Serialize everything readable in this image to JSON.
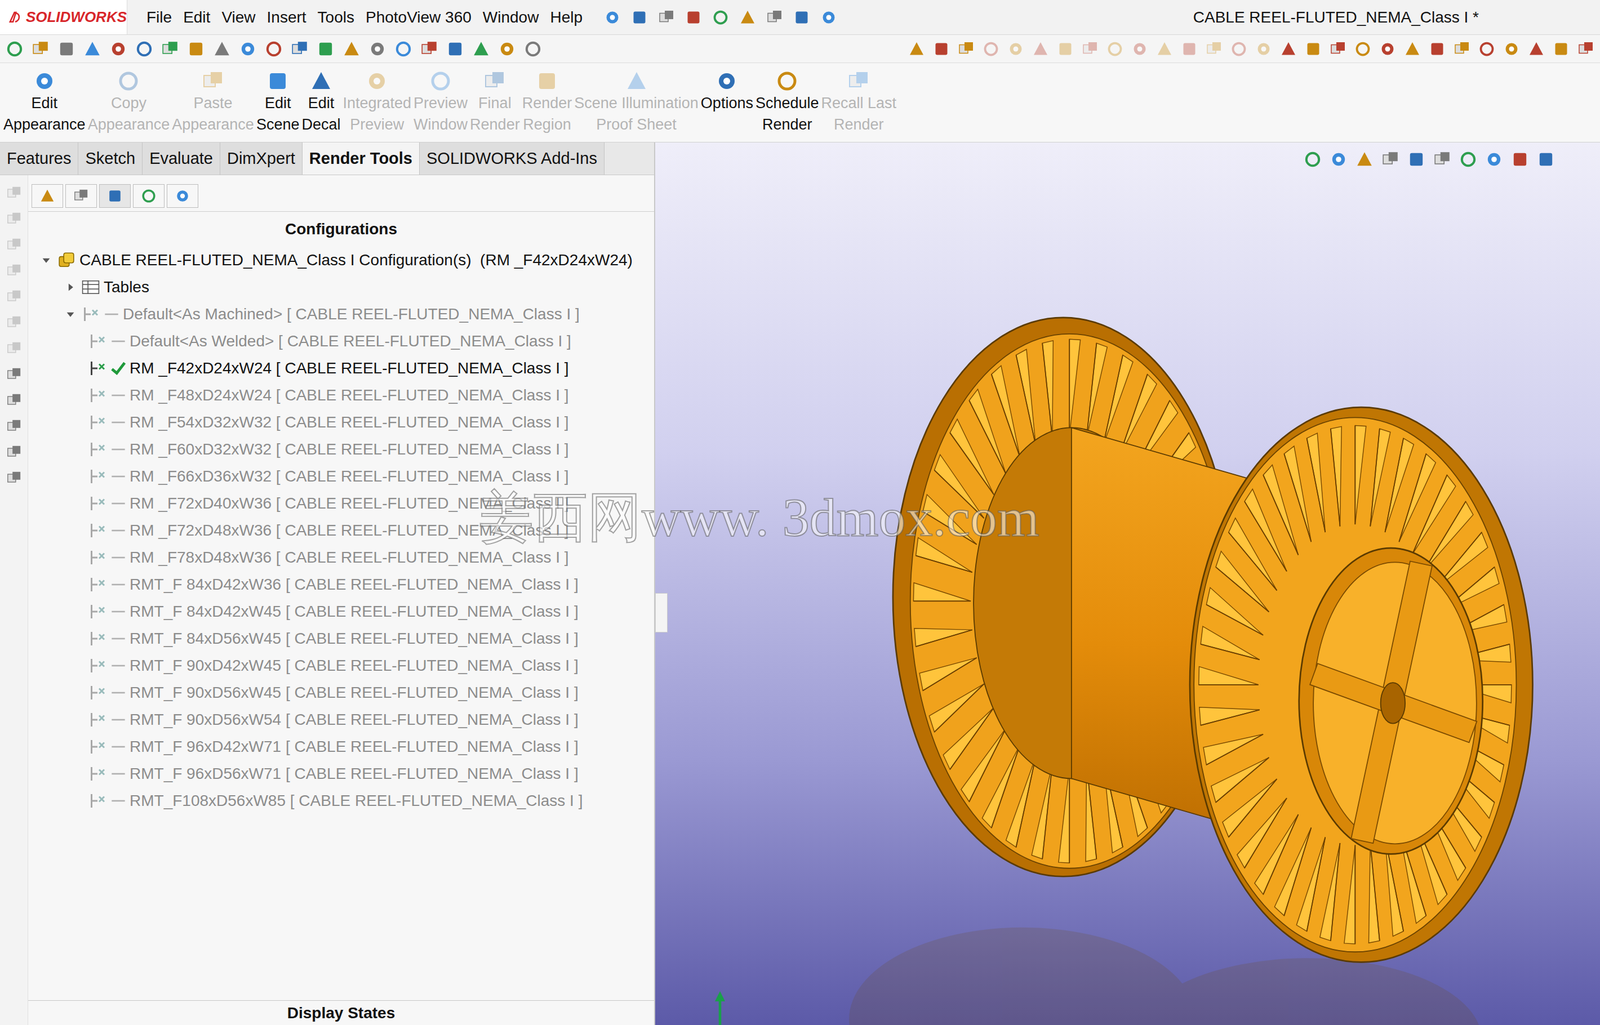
{
  "app": {
    "logo": "SOLIDWORKS",
    "title": "CABLE REEL-FLUTED_NEMA_Class I *"
  },
  "menu": [
    "File",
    "Edit",
    "View",
    "Insert",
    "Tools",
    "PhotoView 360",
    "Window",
    "Help"
  ],
  "commands": [
    {
      "lines": [
        "Edit",
        "Appearance"
      ],
      "disabled": false
    },
    {
      "lines": [
        "Copy",
        "Appearance"
      ],
      "disabled": true
    },
    {
      "lines": [
        "Paste",
        "Appearance"
      ],
      "disabled": true
    },
    {
      "lines": [
        "Edit",
        "Scene"
      ],
      "disabled": false
    },
    {
      "lines": [
        "Edit",
        "Decal"
      ],
      "disabled": false
    },
    {
      "lines": [
        "Integrated",
        "Preview"
      ],
      "disabled": true
    },
    {
      "lines": [
        "Preview",
        "Window"
      ],
      "disabled": true
    },
    {
      "lines": [
        "Final",
        "Render"
      ],
      "disabled": true
    },
    {
      "lines": [
        "Render",
        "Region"
      ],
      "disabled": true
    },
    {
      "lines": [
        "Scene Illumination",
        "Proof Sheet"
      ],
      "disabled": true
    },
    {
      "lines": [
        "Options",
        ""
      ],
      "disabled": false
    },
    {
      "lines": [
        "Schedule",
        "Render"
      ],
      "disabled": false
    },
    {
      "lines": [
        "Recall Last",
        "Render"
      ],
      "disabled": true
    }
  ],
  "tabs": [
    {
      "label": "Features",
      "selected": false
    },
    {
      "label": "Sketch",
      "selected": false
    },
    {
      "label": "Evaluate",
      "selected": false
    },
    {
      "label": "DimXpert",
      "selected": false
    },
    {
      "label": "Render Tools",
      "selected": true
    },
    {
      "label": "SOLIDWORKS Add-Ins",
      "selected": false
    }
  ],
  "panel": {
    "header": "Configurations",
    "footer": "Display States"
  },
  "tree": {
    "root": {
      "label": "CABLE REEL-FLUTED_NEMA_Class I Configuration(s)  (RM _F42xD24xW24)",
      "expanded": true
    },
    "items": [
      {
        "label": "Tables",
        "kind": "tables",
        "level": 1,
        "expanded": false,
        "active": false,
        "greyed": false
      },
      {
        "label": "Default<As Machined> [ CABLE REEL-FLUTED_NEMA_Class I ]",
        "kind": "parent",
        "level": 1,
        "expanded": true,
        "active": false,
        "greyed": true
      },
      {
        "label": "Default<As Welded> [ CABLE REEL-FLUTED_NEMA_Class I ]",
        "kind": "config",
        "level": 2,
        "expanded": false,
        "active": false,
        "greyed": true
      },
      {
        "label": "RM _F42xD24xW24 [ CABLE REEL-FLUTED_NEMA_Class I ]",
        "kind": "config",
        "level": 2,
        "expanded": false,
        "active": true,
        "greyed": false
      },
      {
        "label": "RM _F48xD24xW24 [ CABLE REEL-FLUTED_NEMA_Class I ]",
        "kind": "config",
        "level": 2,
        "expanded": false,
        "active": false,
        "greyed": true
      },
      {
        "label": "RM _F54xD32xW32 [ CABLE REEL-FLUTED_NEMA_Class I ]",
        "kind": "config",
        "level": 2,
        "expanded": false,
        "active": false,
        "greyed": true
      },
      {
        "label": "RM _F60xD32xW32 [ CABLE REEL-FLUTED_NEMA_Class I ]",
        "kind": "config",
        "level": 2,
        "expanded": false,
        "active": false,
        "greyed": true
      },
      {
        "label": "RM _F66xD36xW32 [ CABLE REEL-FLUTED_NEMA_Class I ]",
        "kind": "config",
        "level": 2,
        "expanded": false,
        "active": false,
        "greyed": true
      },
      {
        "label": "RM _F72xD40xW36 [ CABLE REEL-FLUTED_NEMA_Class I ]",
        "kind": "config",
        "level": 2,
        "expanded": false,
        "active": false,
        "greyed": true
      },
      {
        "label": "RM _F72xD48xW36 [ CABLE REEL-FLUTED_NEMA_Class I ]",
        "kind": "config",
        "level": 2,
        "expanded": false,
        "active": false,
        "greyed": true
      },
      {
        "label": "RM _F78xD48xW36 [ CABLE REEL-FLUTED_NEMA_Class I ]",
        "kind": "config",
        "level": 2,
        "expanded": false,
        "active": false,
        "greyed": true
      },
      {
        "label": "RMT_F 84xD42xW36 [ CABLE REEL-FLUTED_NEMA_Class I ]",
        "kind": "config",
        "level": 2,
        "expanded": false,
        "active": false,
        "greyed": true
      },
      {
        "label": "RMT_F 84xD42xW45 [ CABLE REEL-FLUTED_NEMA_Class I ]",
        "kind": "config",
        "level": 2,
        "expanded": false,
        "active": false,
        "greyed": true
      },
      {
        "label": "RMT_F 84xD56xW45 [ CABLE REEL-FLUTED_NEMA_Class I ]",
        "kind": "config",
        "level": 2,
        "expanded": false,
        "active": false,
        "greyed": true
      },
      {
        "label": "RMT_F 90xD42xW45 [ CABLE REEL-FLUTED_NEMA_Class I ]",
        "kind": "config",
        "level": 2,
        "expanded": false,
        "active": false,
        "greyed": true
      },
      {
        "label": "RMT_F 90xD56xW45 [ CABLE REEL-FLUTED_NEMA_Class I ]",
        "kind": "config",
        "level": 2,
        "expanded": false,
        "active": false,
        "greyed": true
      },
      {
        "label": "RMT_F 90xD56xW54 [ CABLE REEL-FLUTED_NEMA_Class I ]",
        "kind": "config",
        "level": 2,
        "expanded": false,
        "active": false,
        "greyed": true
      },
      {
        "label": "RMT_F 96xD42xW71 [ CABLE REEL-FLUTED_NEMA_Class I ]",
        "kind": "config",
        "level": 2,
        "expanded": false,
        "active": false,
        "greyed": true
      },
      {
        "label": "RMT_F 96xD56xW71 [ CABLE REEL-FLUTED_NEMA_Class I ]",
        "kind": "config",
        "level": 2,
        "expanded": false,
        "active": false,
        "greyed": true
      },
      {
        "label": "RMT_F108xD56xW85 [ CABLE REEL-FLUTED_NEMA_Class I ]",
        "kind": "config",
        "level": 2,
        "expanded": false,
        "active": false,
        "greyed": true
      }
    ]
  },
  "watermark": "姜西网www. 3dmox.com"
}
